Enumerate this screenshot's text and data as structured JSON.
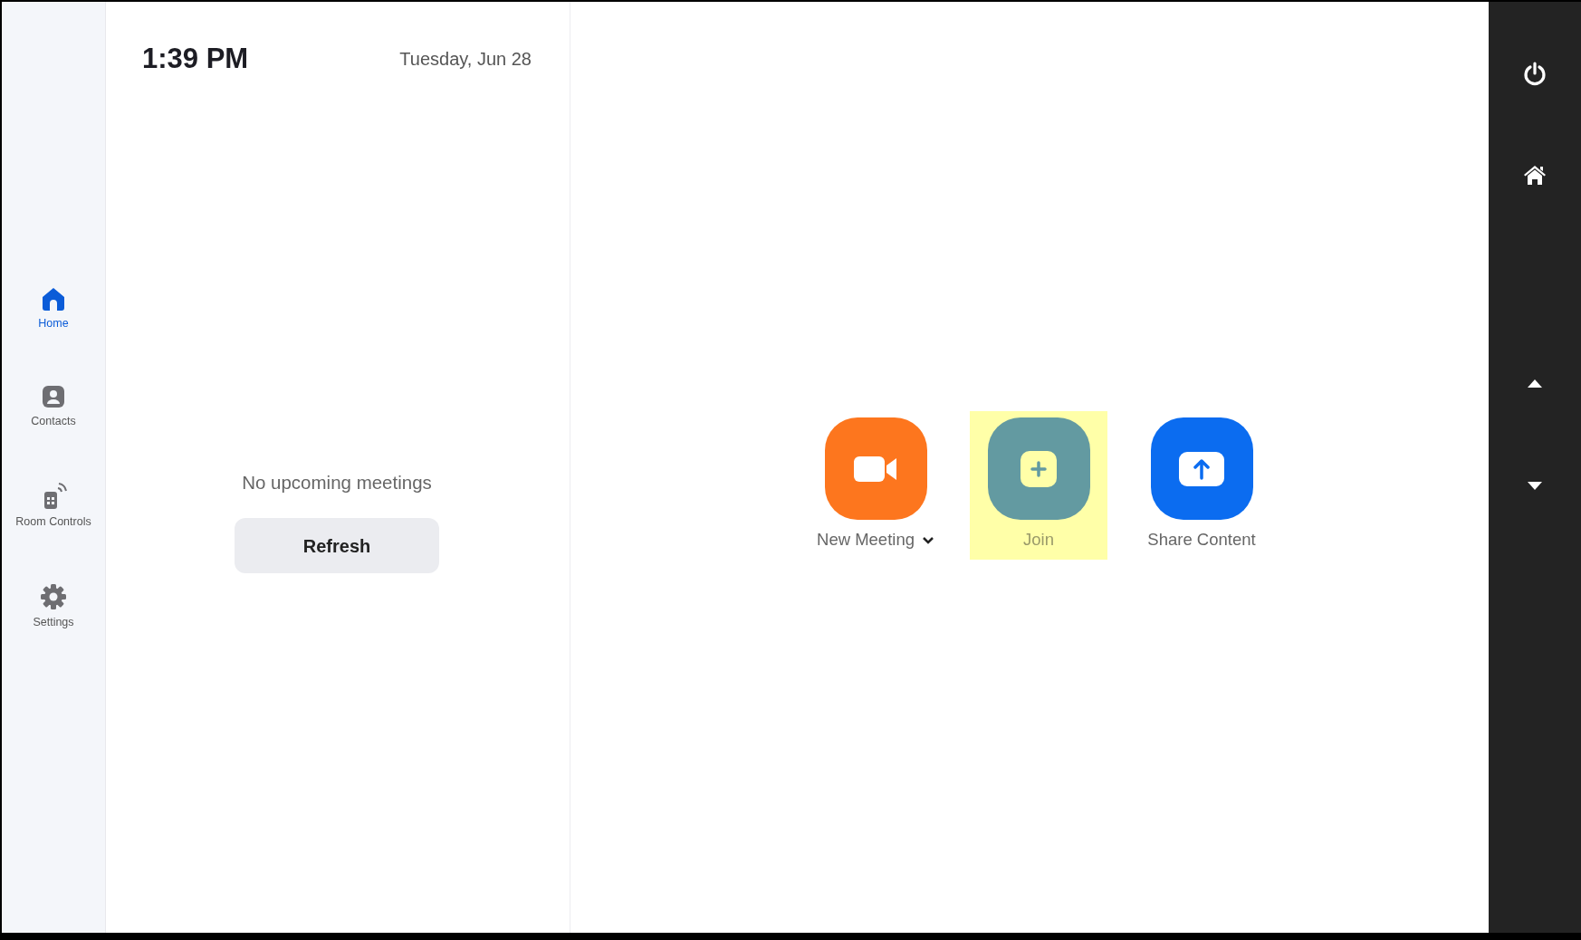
{
  "sidebar": {
    "items": [
      {
        "kind": "home",
        "label": "Home",
        "selected": true
      },
      {
        "kind": "contacts",
        "label": "Contacts",
        "selected": false
      },
      {
        "kind": "room-controls",
        "label": "Room Controls",
        "selected": false
      },
      {
        "kind": "settings",
        "label": "Settings",
        "selected": false
      }
    ]
  },
  "schedule": {
    "time": "1:39 PM",
    "date": "Tuesday, Jun 28",
    "empty_message": "No upcoming meetings",
    "refresh_button": "Refresh"
  },
  "actions": [
    {
      "kind": "video",
      "label": "New Meeting",
      "color": "#fd761e",
      "has_dropdown": true,
      "highlighted": false
    },
    {
      "kind": "plus",
      "label": "Join",
      "color": "#639aa1",
      "has_dropdown": false,
      "highlighted": true
    },
    {
      "kind": "share",
      "label": "Share Content",
      "color": "#0b6cf0",
      "has_dropdown": false,
      "highlighted": false
    }
  ]
}
